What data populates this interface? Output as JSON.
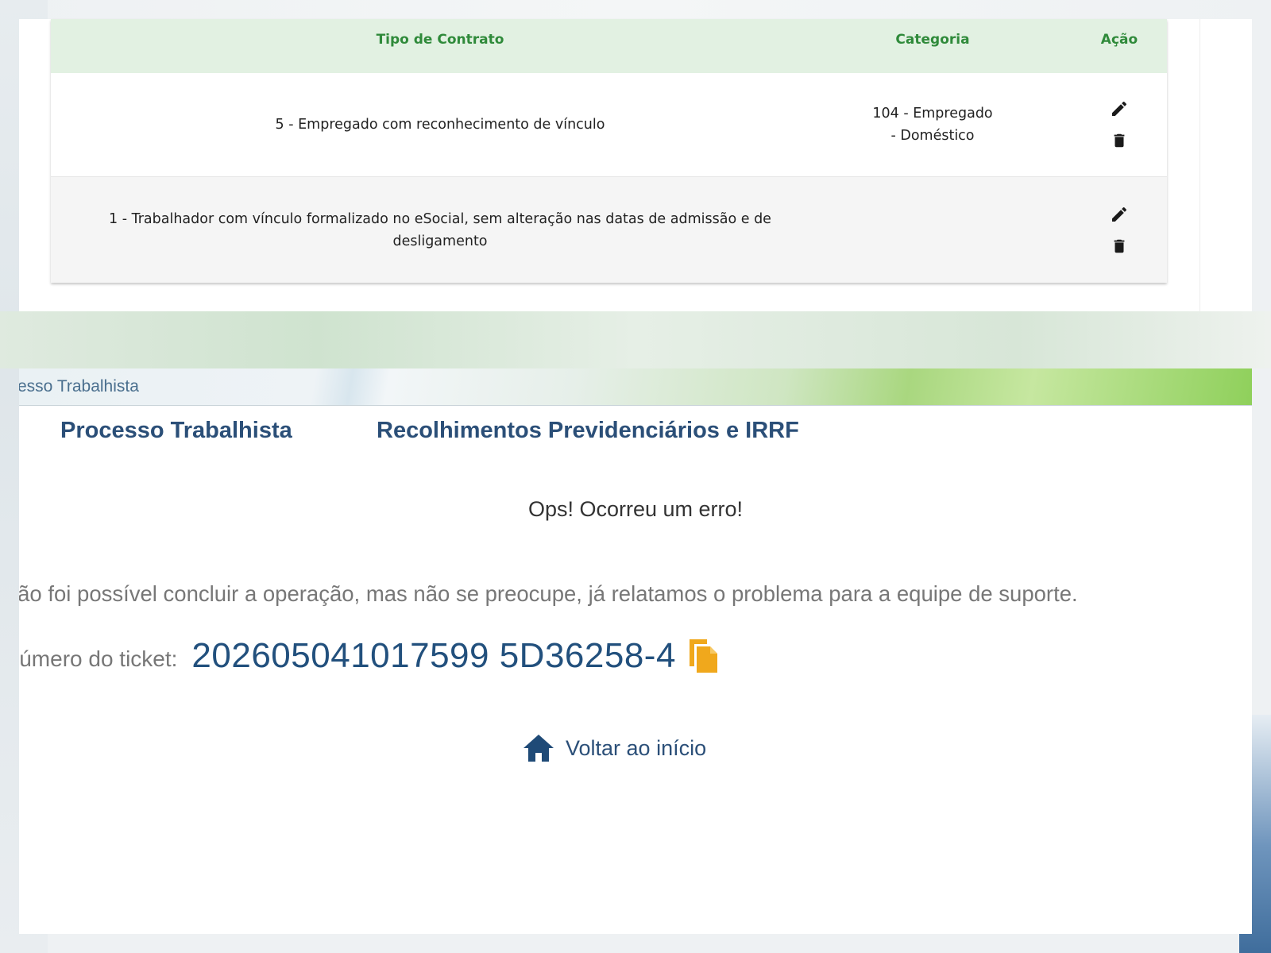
{
  "table": {
    "headers": {
      "contract_type": "Tipo de Contrato",
      "category": "Categoria",
      "action": "Ação"
    },
    "rows": [
      {
        "contract_type": "5 - Empregado com reconhecimento de vínculo",
        "category": "104 - Empregado - Doméstico"
      },
      {
        "contract_type": "1 - Trabalhador com vínculo formalizado no eSocial, sem alteração nas datas de admissão e de desligamento",
        "category": ""
      }
    ],
    "action_icons": [
      "edit-icon",
      "delete-icon"
    ]
  },
  "error_page": {
    "breadcrumb": "esso Trabalhista",
    "tabs": [
      "Processo Trabalhista",
      "Recolhimentos Previdenciários e IRRF"
    ],
    "title": "Ops! Ocorreu um erro!",
    "message": "lão foi possível concluir a operação, mas não se preocupe, já relatamos o problema para a equipe de suporte.",
    "ticket_label": "lúmero do ticket:",
    "ticket_number": "202605041017599 5D36258-4",
    "home_link": "Voltar ao início",
    "icons": {
      "copy": "copy-icon",
      "home": "home-icon"
    }
  },
  "colors": {
    "table_header_bg": "#e2f1e2",
    "table_header_text": "#2f8a3a",
    "nav_text": "#2b4f78",
    "ticket_text": "#22507d",
    "copy_icon": "#f0a81c"
  }
}
